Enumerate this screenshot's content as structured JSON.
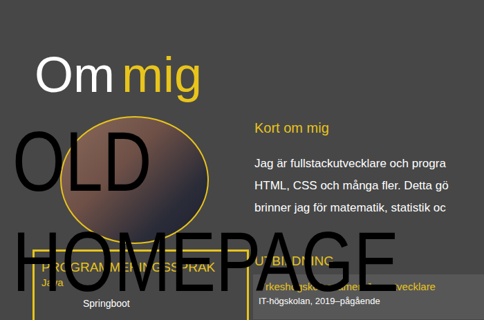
{
  "title": {
    "first": "Om",
    "second": "mig"
  },
  "about": {
    "heading": "Kort om mig",
    "lines": [
      "Jag är fullstackutvecklare och progra",
      "HTML, CSS och många fler. Detta gö",
      "brinner jag för matematik, statistik oc"
    ]
  },
  "skills": {
    "heading": "PROGRAMMERINGSSPRÅK",
    "language": "Java",
    "items": [
      "Springboot"
    ]
  },
  "education": {
    "heading": "UTBILDNING",
    "items": [
      {
        "degree": "Yrkeshögskoleexamen Javautvecklare",
        "school": "IT-högskolan, 2019–pågående"
      }
    ]
  },
  "watermark": [
    "OLD",
    "HOMEPAGE"
  ]
}
